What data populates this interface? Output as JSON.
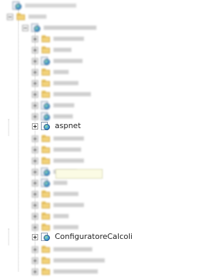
{
  "tree": {
    "aspnet_label": "aspnet",
    "configuratore_label": "ConfiguratoreCalcoli"
  }
}
